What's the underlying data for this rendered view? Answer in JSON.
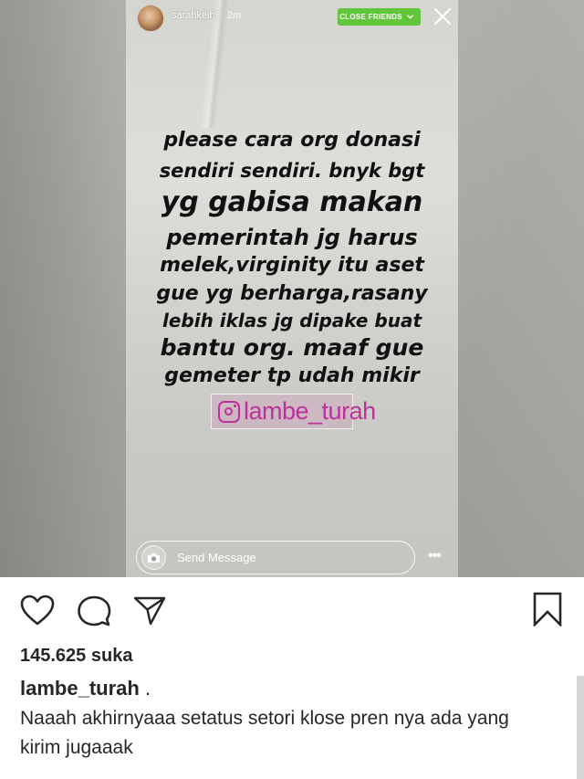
{
  "story": {
    "username": "sarahkeihl",
    "time": "2m",
    "audience_badge": "CLOSE FRIENDS",
    "text_lines": [
      "please cara org donasi",
      "sendiri sendiri. bnyk bgt",
      "yg gabisa makan",
      "pemerintah jg harus",
      "melek,virginity itu aset",
      "gue yg berharga,rasany",
      "lebih iklas jg dipake buat",
      "bantu org. maaf gue",
      "gemeter tp udah mikir"
    ],
    "watermark": "lambe_turah",
    "reply_placeholder": "Send Message",
    "icons": {
      "close": "close-icon",
      "camera": "camera-icon",
      "more": "more-icon",
      "instagram": "instagram-icon"
    }
  },
  "post": {
    "likes": "145.625 suka",
    "author": "lambe_turah",
    "author_suffix": ".",
    "caption": "Naaah akhirnyaaa setatus setori klose pren nya ada yang kirim jugaaak",
    "icons": [
      "heart-icon",
      "comment-icon",
      "share-icon",
      "bookmark-icon"
    ]
  },
  "colors": {
    "close_friends_green": "#62c63a",
    "watermark_pink": "#c0309a",
    "text_dark": "#262626"
  }
}
